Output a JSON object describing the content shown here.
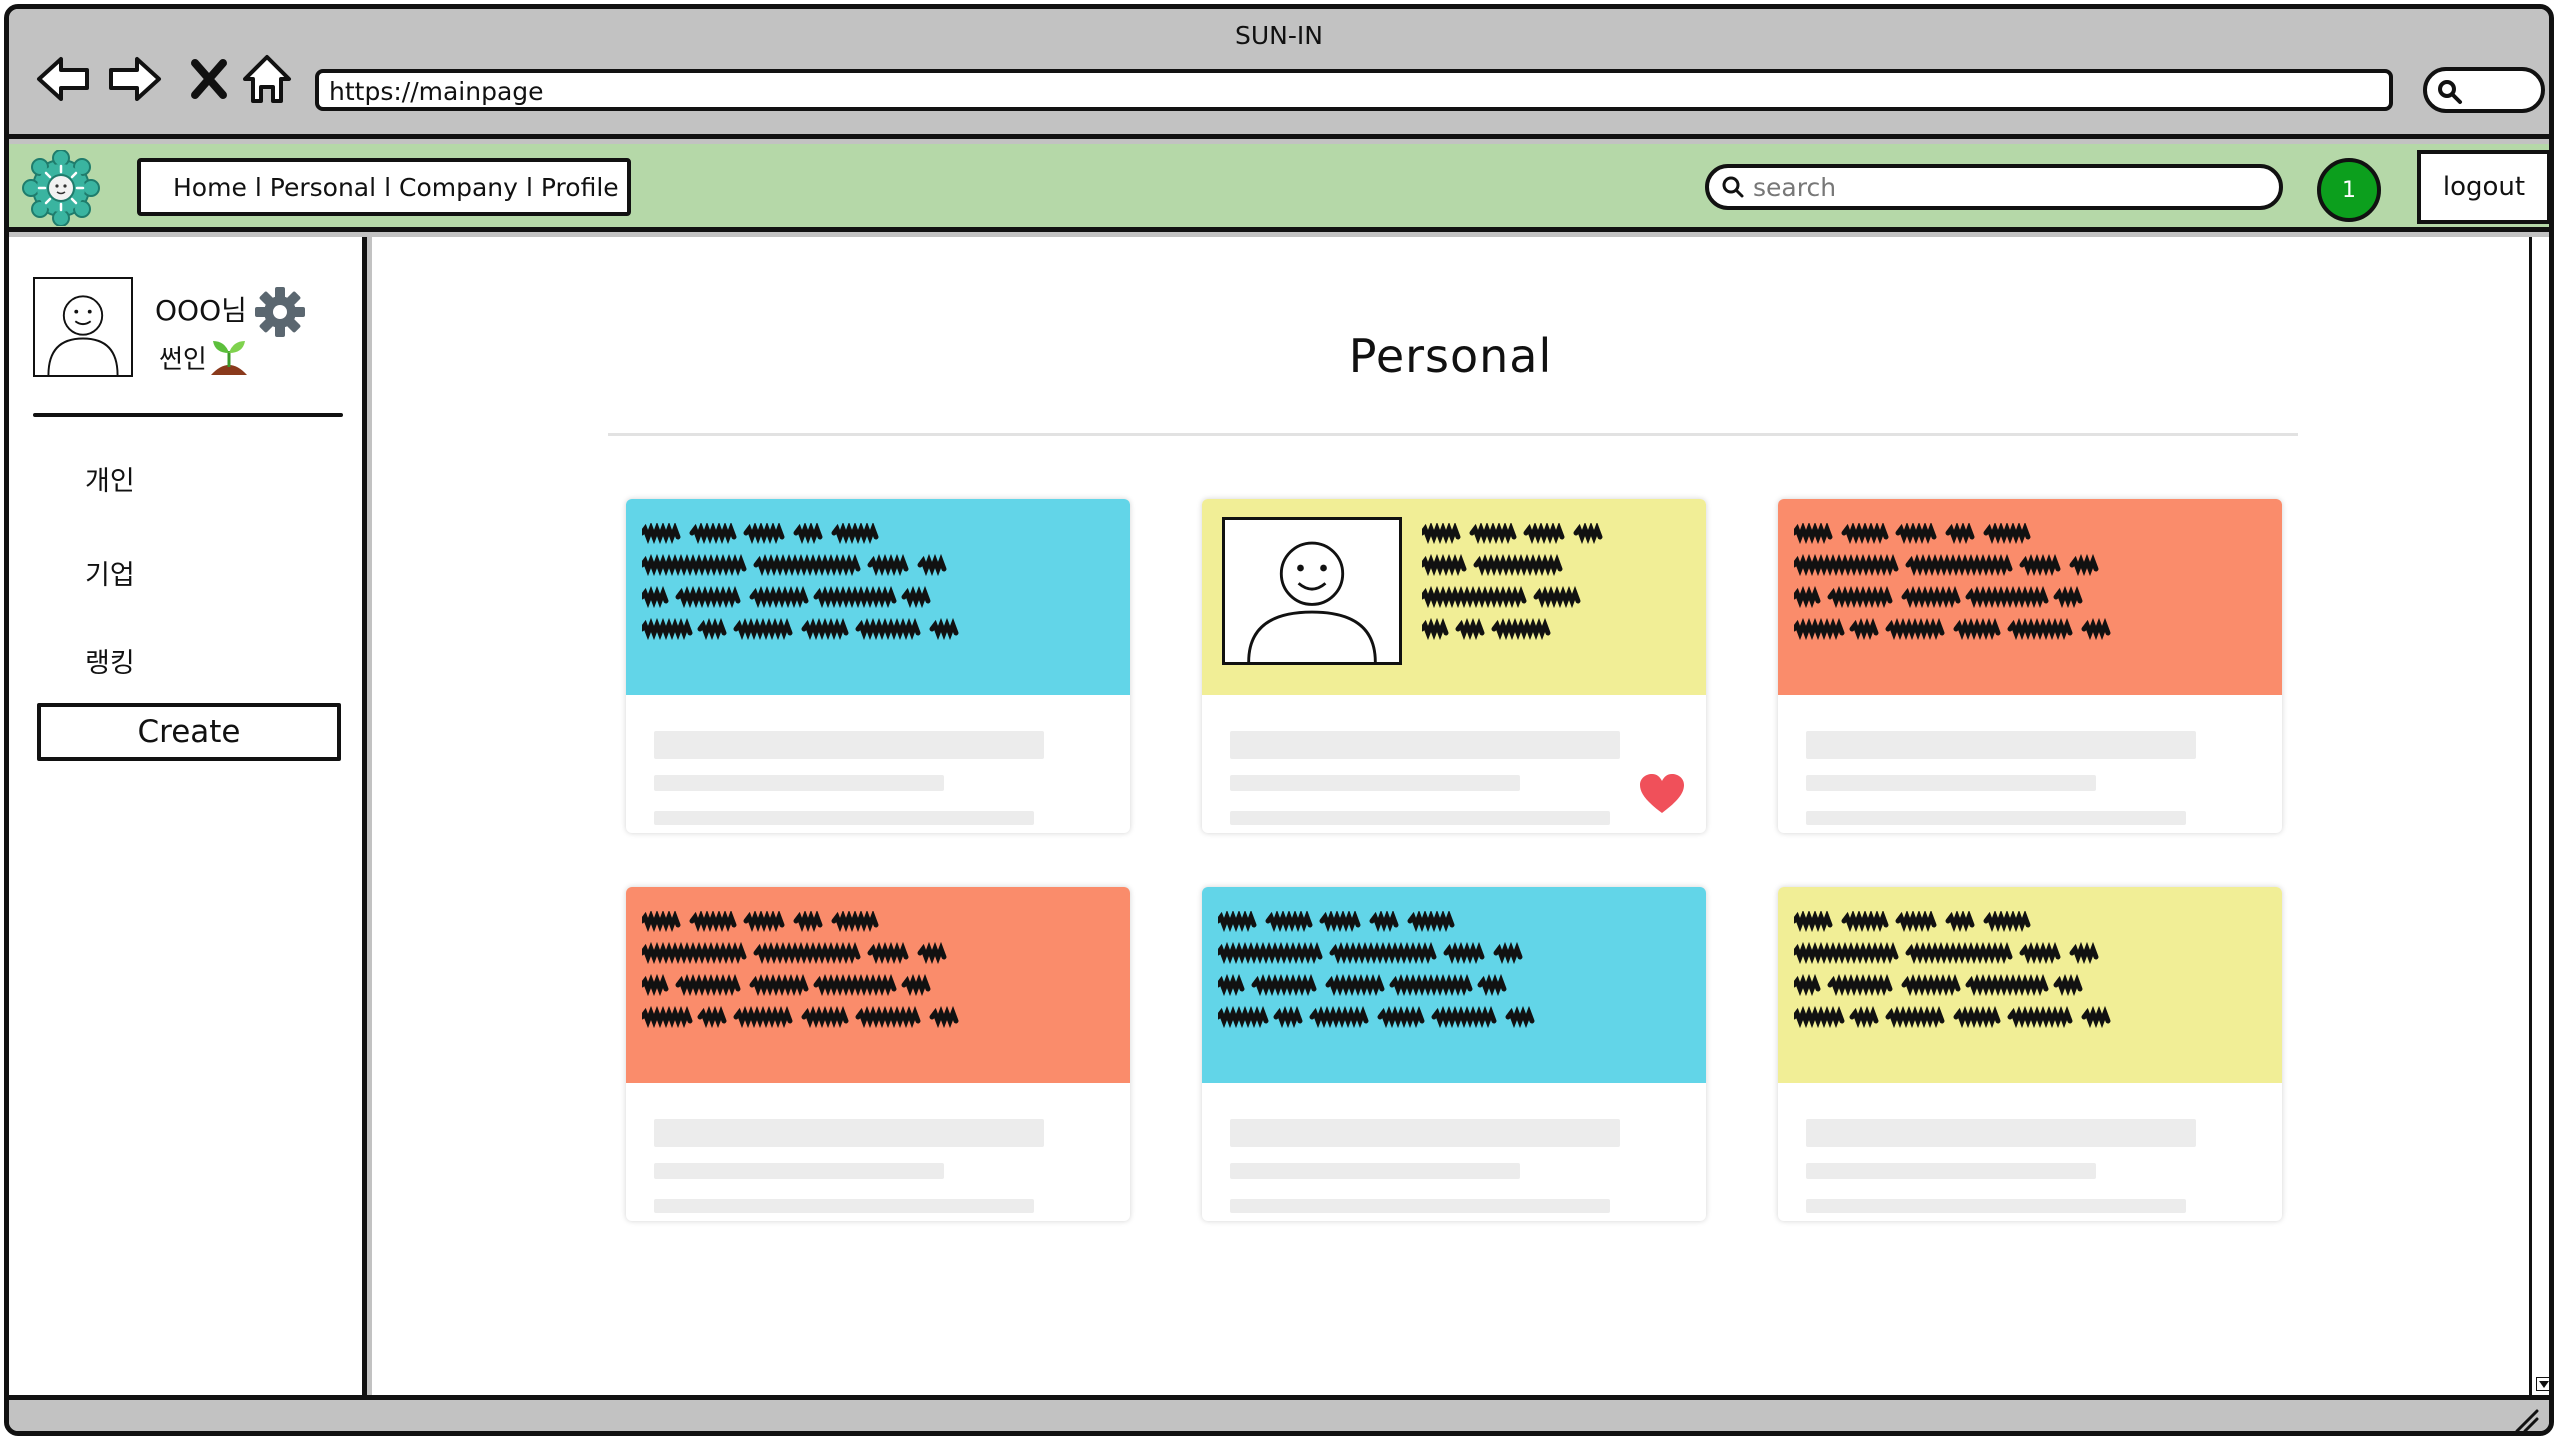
{
  "window": {
    "title": "SUN-IN"
  },
  "browser": {
    "url": "https://mainpage",
    "buttons": {
      "back_icon": "back-arrow-icon",
      "forward_icon": "forward-arrow-icon",
      "stop_icon": "close-icon",
      "home_icon": "home-icon"
    }
  },
  "header": {
    "menu": {
      "home": "Home",
      "personal": "Personal",
      "company": "Company",
      "profile": "Profile",
      "separator": "l"
    },
    "search_placeholder": "search",
    "notification_count": "1",
    "logout": "logout",
    "colors": {
      "bar": "#b5d8a8",
      "notification": "#0c9f1d"
    }
  },
  "sidebar": {
    "user_name": "OOO님",
    "user_rank": "썬인",
    "items": [
      {
        "label": "개인"
      },
      {
        "label": "기업"
      },
      {
        "label": "랭킹"
      }
    ],
    "create_label": "Create"
  },
  "main": {
    "title": "Personal",
    "cards": [
      {
        "color": "#62d5e8",
        "has_photo": false,
        "liked": false
      },
      {
        "color": "#f1ee96",
        "has_photo": true,
        "liked": true
      },
      {
        "color": "#fa8c6b",
        "has_photo": false,
        "liked": false
      },
      {
        "color": "#fa8c6b",
        "has_photo": false,
        "liked": false
      },
      {
        "color": "#62d5e8",
        "has_photo": false,
        "liked": false
      },
      {
        "color": "#f1ee96",
        "has_photo": false,
        "liked": false
      }
    ]
  }
}
